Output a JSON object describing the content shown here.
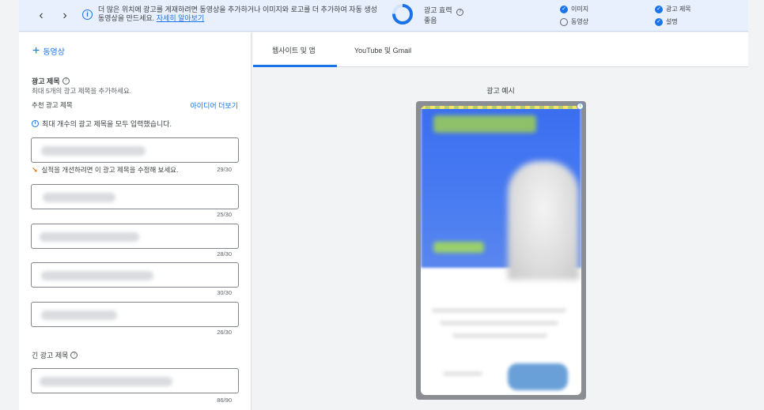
{
  "banner": {
    "text": "더 많은 위치에 광고를 게재하려면 동영상을 추가하거나 이미지와 로고를 더 추가하여 자동 생성 동영상을 만드세요.",
    "link": "자세히 알아보기",
    "strength_label": "광고 효력",
    "strength_value": "좋음",
    "checklist": [
      {
        "label": "이미지",
        "checked": true
      },
      {
        "label": "동영상",
        "checked": false
      },
      {
        "label": "광고 제목",
        "checked": true
      },
      {
        "label": "설명",
        "checked": true
      }
    ]
  },
  "left": {
    "add_video": "동영상",
    "headlines_title": "광고 제목",
    "headlines_hint": "최대 5개의 광고 제목을 추가하세요.",
    "recommended_label": "추천 광고 제목",
    "more_ideas": "아이디어 더보기",
    "max_info": "최대 개수의 광고 제목을 모두 입력했습니다.",
    "warn_text": "실적을 개선하려면 이 광고 제목을 수정해 보세요.",
    "headlines": [
      {
        "counter": "29/30"
      },
      {
        "counter": "25/30"
      },
      {
        "counter": "28/30"
      },
      {
        "counter": "30/30"
      },
      {
        "counter": "26/30"
      }
    ],
    "long_headline_title": "긴 광고 제목",
    "long_headline_counter": "86/90"
  },
  "tabs": {
    "websites": "웹사이트 및 앱",
    "youtube": "YouTube 및 Gmail"
  },
  "preview": {
    "label": "광고 예시"
  },
  "colors": {
    "accent": "#1a73e8",
    "banner_bg": "#e8f0fe",
    "warning": "#e37400"
  }
}
